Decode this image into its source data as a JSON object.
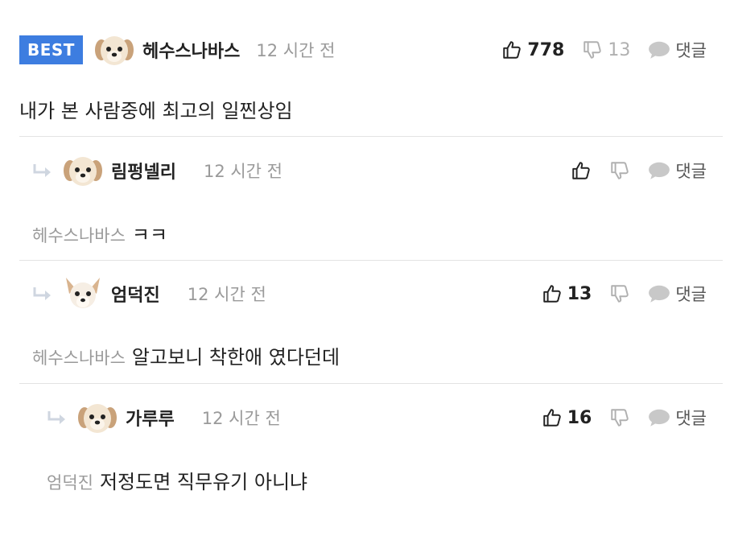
{
  "comments": [
    {
      "badge": "BEST",
      "nickname": "헤수스나바스",
      "time": "12 시간 전",
      "likes": "778",
      "dislikes": "13",
      "reply_label": "댓글",
      "mention": "",
      "text": "내가 본 사람중에 최고의 일찐상임",
      "avatar_icon": "dog-avatar-icon"
    },
    {
      "nickname": "림펑넬리",
      "time": "12 시간 전",
      "likes": "",
      "dislikes": "",
      "reply_label": "댓글",
      "mention": "헤수스나바스",
      "text": "ㅋㅋ",
      "avatar_icon": "dog-avatar-icon"
    },
    {
      "nickname": "엄덕진",
      "time": "12 시간 전",
      "likes": "13",
      "dislikes": "",
      "reply_label": "댓글",
      "mention": "헤수스나바스",
      "text": "알고보니 착한애 였다던데",
      "avatar_icon": "chihuahua-avatar-icon"
    },
    {
      "nickname": "가루루",
      "time": "12 시간 전",
      "likes": "16",
      "dislikes": "",
      "reply_label": "댓글",
      "mention": "엄덕진",
      "text": "저정도면 직무유기 아니냐",
      "avatar_icon": "dog-avatar-icon"
    }
  ],
  "colors": {
    "best_badge": "#3d7de0",
    "time": "#9a9a9a",
    "divider": "#e3e3e3"
  }
}
